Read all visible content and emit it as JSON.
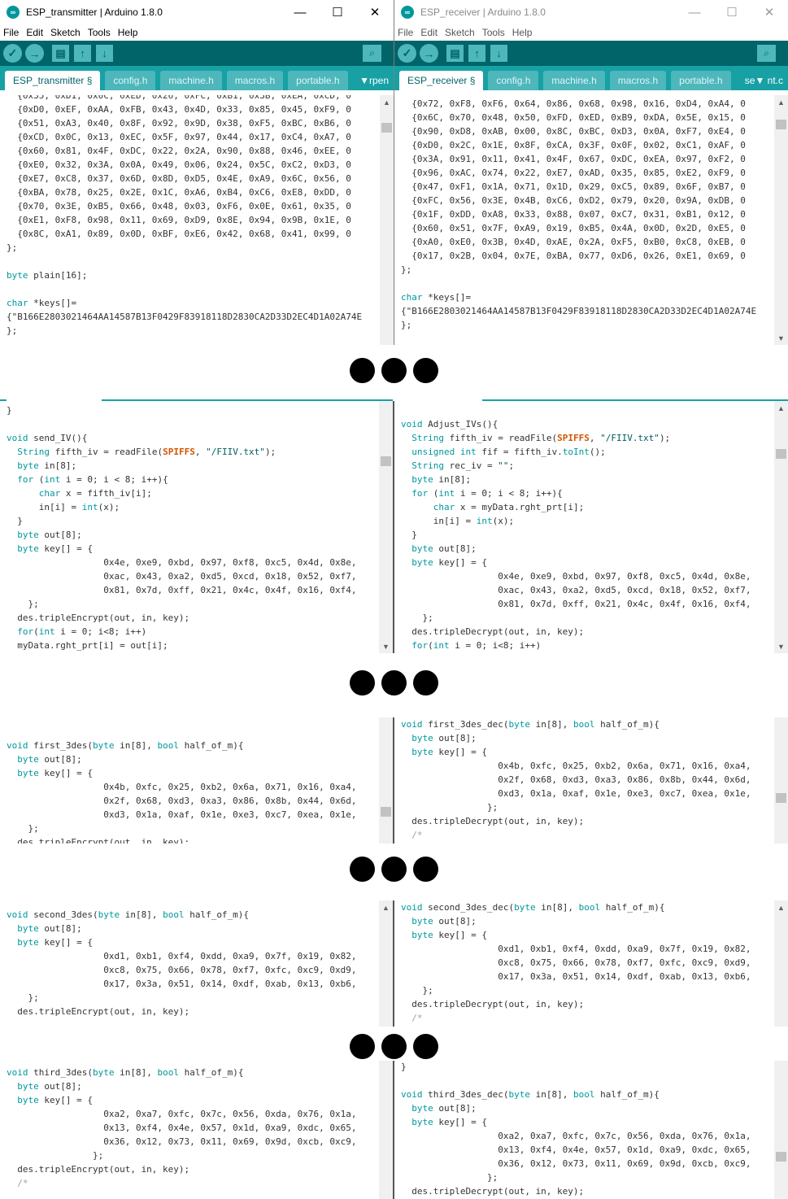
{
  "left_window": {
    "title": "ESP_transmitter | Arduino 1.8.0",
    "icon": "arduino-logo-icon",
    "menus": [
      "File",
      "Edit",
      "Sketch",
      "Tools",
      "Help"
    ],
    "tabs": [
      "ESP_transmitter §",
      "config.h",
      "machine.h",
      "macros.h",
      "portable.h",
      "rpen"
    ],
    "tab_menu": "▼",
    "code": [
      "  {0x35, 0xD1, 0x0C, 0xED, 0x26, 0xFC, 0xB1, 0x3B, 0xEA, 0xCD, 0",
      "  {0xD0, 0xEF, 0xAA, 0xFB, 0x43, 0x4D, 0x33, 0x85, 0x45, 0xF9, 0",
      "  {0x51, 0xA3, 0x40, 0x8F, 0x92, 0x9D, 0x38, 0xF5, 0xBC, 0xB6, 0",
      "  {0xCD, 0x0C, 0x13, 0xEC, 0x5F, 0x97, 0x44, 0x17, 0xC4, 0xA7, 0",
      "  {0x60, 0x81, 0x4F, 0xDC, 0x22, 0x2A, 0x90, 0x88, 0x46, 0xEE, 0",
      "  {0xE0, 0x32, 0x3A, 0x0A, 0x49, 0x06, 0x24, 0x5C, 0xC2, 0xD3, 0",
      "  {0xE7, 0xC8, 0x37, 0x6D, 0x8D, 0xD5, 0x4E, 0xA9, 0x6C, 0x56, 0",
      "  {0xBA, 0x78, 0x25, 0x2E, 0x1C, 0xA6, 0xB4, 0xC6, 0xE8, 0xDD, 0",
      "  {0x70, 0x3E, 0xB5, 0x66, 0x48, 0x03, 0xF6, 0x0E, 0x61, 0x35, 0",
      "  {0xE1, 0xF8, 0x98, 0x11, 0x69, 0xD9, 0x8E, 0x94, 0x9B, 0x1E, 0",
      "  {0x8C, 0xA1, 0x89, 0x0D, 0xBF, 0xE6, 0x42, 0x68, 0x41, 0x99, 0",
      "};",
      "",
      "byte plain[16];",
      "",
      "char *keys[]=",
      "{\"B166E2803021464AA14587B13F0429F83918118D2830CA2D33D2EC4D1A02A74E",
      "};"
    ]
  },
  "right_window": {
    "title": "ESP_receiver | Arduino 1.8.0",
    "icon": "arduino-logo-icon",
    "menus": [
      "File",
      "Edit",
      "Sketch",
      "Tools",
      "Help"
    ],
    "tabs": [
      "ESP_receiver §",
      "config.h",
      "machine.h",
      "macros.h",
      "portable.h",
      "se"
    ],
    "tab_menu": "▼ nt.c",
    "code": [
      "  {0x72, 0xF8, 0xF6, 0x64, 0x86, 0x68, 0x98, 0x16, 0xD4, 0xA4, 0",
      "  {0x6C, 0x70, 0x48, 0x50, 0xFD, 0xED, 0xB9, 0xDA, 0x5E, 0x15, 0",
      "  {0x90, 0xD8, 0xAB, 0x00, 0x8C, 0xBC, 0xD3, 0x0A, 0xF7, 0xE4, 0",
      "  {0xD0, 0x2C, 0x1E, 0x8F, 0xCA, 0x3F, 0x0F, 0x02, 0xC1, 0xAF, 0",
      "  {0x3A, 0x91, 0x11, 0x41, 0x4F, 0x67, 0xDC, 0xEA, 0x97, 0xF2, 0",
      "  {0x96, 0xAC, 0x74, 0x22, 0xE7, 0xAD, 0x35, 0x85, 0xE2, 0xF9, 0",
      "  {0x47, 0xF1, 0x1A, 0x71, 0x1D, 0x29, 0xC5, 0x89, 0x6F, 0xB7, 0",
      "  {0xFC, 0x56, 0x3E, 0x4B, 0xC6, 0xD2, 0x79, 0x20, 0x9A, 0xDB, 0",
      "  {0x1F, 0xDD, 0xA8, 0x33, 0x88, 0x07, 0xC7, 0x31, 0xB1, 0x12, 0",
      "  {0x60, 0x51, 0x7F, 0xA9, 0x19, 0xB5, 0x4A, 0x0D, 0x2D, 0xE5, 0",
      "  {0xA0, 0xE0, 0x3B, 0x4D, 0xAE, 0x2A, 0xF5, 0xB0, 0xC8, 0xEB, 0",
      "  {0x17, 0x2B, 0x04, 0x7E, 0xBA, 0x77, 0xD6, 0x26, 0xE1, 0x69, 0",
      "};",
      "",
      "char *keys[]=",
      "{\"B166E2803021464AA14587B13F0429F83918118D2830CA2D33D2EC4D1A02A74E",
      "};"
    ]
  },
  "segments": [
    {
      "left": [
        "}",
        "",
        "void send_IV(){",
        "  String fifth_iv = readFile(SPIFFS, \"/FIIV.txt\");",
        "  byte in[8];",
        "  for (int i = 0; i < 8; i++){",
        "      char x = fifth_iv[i];",
        "      in[i] = int(x);",
        "  }",
        "  byte out[8];",
        "  byte key[] = {",
        "                  0x4e, 0xe9, 0xbd, 0x97, 0xf8, 0xc5, 0x4d, 0x8e,",
        "                  0xac, 0x43, 0xa2, 0xd5, 0xcd, 0x18, 0x52, 0xf7,",
        "                  0x81, 0x7d, 0xff, 0x21, 0x4c, 0x4f, 0x16, 0xf4,",
        "    };",
        "  des.tripleEncrypt(out, in, key);",
        "  for(int i = 0; i<8; i++)",
        "  myData.rght_prt[i] = out[i];"
      ],
      "right": [
        "",
        "void Adjust_IVs(){",
        "  String fifth_iv = readFile(SPIFFS, \"/FIIV.txt\");",
        "  unsigned int fif = fifth_iv.toInt();",
        "  String rec_iv = \"\";",
        "  byte in[8];",
        "  for (int i = 0; i < 8; i++){",
        "      char x = myData.rght_prt[i];",
        "      in[i] = int(x);",
        "  }",
        "  byte out[8];",
        "  byte key[] = {",
        "                  0x4e, 0xe9, 0xbd, 0x97, 0xf8, 0xc5, 0x4d, 0x8e,",
        "                  0xac, 0x43, 0xa2, 0xd5, 0xcd, 0x18, 0x52, 0xf7,",
        "                  0x81, 0x7d, 0xff, 0x21, 0x4c, 0x4f, 0x16, 0xf4,",
        "    };",
        "  des.tripleDecrypt(out, in, key);",
        "  for(int i = 0; i<8; i++)"
      ]
    },
    {
      "left": [
        "",
        "",
        "void first_3des(byte in[8], bool half_of_m){",
        "  byte out[8];",
        "  byte key[] = {",
        "                  0x4b, 0xfc, 0x25, 0xb2, 0x6a, 0x71, 0x16, 0xa4,",
        "                  0x2f, 0x68, 0xd3, 0xa3, 0x86, 0x8b, 0x44, 0x6d,",
        "                  0xd3, 0x1a, 0xaf, 0x1e, 0xe3, 0xc7, 0xea, 0x1e,",
        "    };",
        "  des.tripleEncrypt(out, in, key);"
      ],
      "right": [
        "void first_3des_dec(byte in[8], bool half_of_m){",
        "  byte out[8];",
        "  byte key[] = {",
        "                  0x4b, 0xfc, 0x25, 0xb2, 0x6a, 0x71, 0x16, 0xa4,",
        "                  0x2f, 0x68, 0xd3, 0xa3, 0x86, 0x8b, 0x44, 0x6d,",
        "                  0xd3, 0x1a, 0xaf, 0x1e, 0xe3, 0xc7, 0xea, 0x1e,",
        "                };",
        "  des.tripleDecrypt(out, in, key);",
        "  /*"
      ]
    },
    {
      "left": [
        "",
        "void second_3des(byte in[8], bool half_of_m){",
        "  byte out[8];",
        "  byte key[] = {",
        "                  0xd1, 0xb1, 0xf4, 0xdd, 0xa9, 0x7f, 0x19, 0x82,",
        "                  0xc8, 0x75, 0x66, 0x78, 0xf7, 0xfc, 0xc9, 0xd9,",
        "                  0x17, 0x3a, 0x51, 0x14, 0xdf, 0xab, 0x13, 0xb6,",
        "    };",
        "  des.tripleEncrypt(out, in, key);"
      ],
      "right": [
        "void second_3des_dec(byte in[8], bool half_of_m){",
        "  byte out[8];",
        "  byte key[] = {",
        "                  0xd1, 0xb1, 0xf4, 0xdd, 0xa9, 0x7f, 0x19, 0x82,",
        "                  0xc8, 0x75, 0x66, 0x78, 0xf7, 0xfc, 0xc9, 0xd9,",
        "                  0x17, 0x3a, 0x51, 0x14, 0xdf, 0xab, 0x13, 0xb6,",
        "    };",
        "  des.tripleDecrypt(out, in, key);",
        "  /*"
      ]
    },
    {
      "left": [
        "",
        "void third_3des(byte in[8], bool half_of_m){",
        "  byte out[8];",
        "  byte key[] = {",
        "                  0xa2, 0xa7, 0xfc, 0x7c, 0x56, 0xda, 0x76, 0x1a,",
        "                  0x13, 0xf4, 0x4e, 0x57, 0x1d, 0xa9, 0xdc, 0x65,",
        "                  0x36, 0x12, 0x73, 0x11, 0x69, 0x9d, 0xcb, 0xc9,",
        "                };",
        "  des.tripleEncrypt(out, in, key);",
        "  /*"
      ],
      "right": [
        "}",
        "",
        "void third_3des_dec(byte in[8], bool half_of_m){",
        "  byte out[8];",
        "  byte key[] = {",
        "                  0xa2, 0xa7, 0xfc, 0x7c, 0x56, 0xda, 0x76, 0x1a,",
        "                  0x13, 0xf4, 0x4e, 0x57, 0x1d, 0xa9, 0xdc, 0x65,",
        "                  0x36, 0x12, 0x73, 0x11, 0x69, 0x9d, 0xcb, 0xc9,",
        "                };",
        "  des.tripleDecrypt(out, in, key);"
      ]
    }
  ],
  "colors": {
    "toolbar": "#006468",
    "tabbar": "#17a1a5",
    "keyword": "#00979c",
    "constant": "#d35400",
    "string": "#005c5f",
    "comment": "#95a5a6"
  }
}
